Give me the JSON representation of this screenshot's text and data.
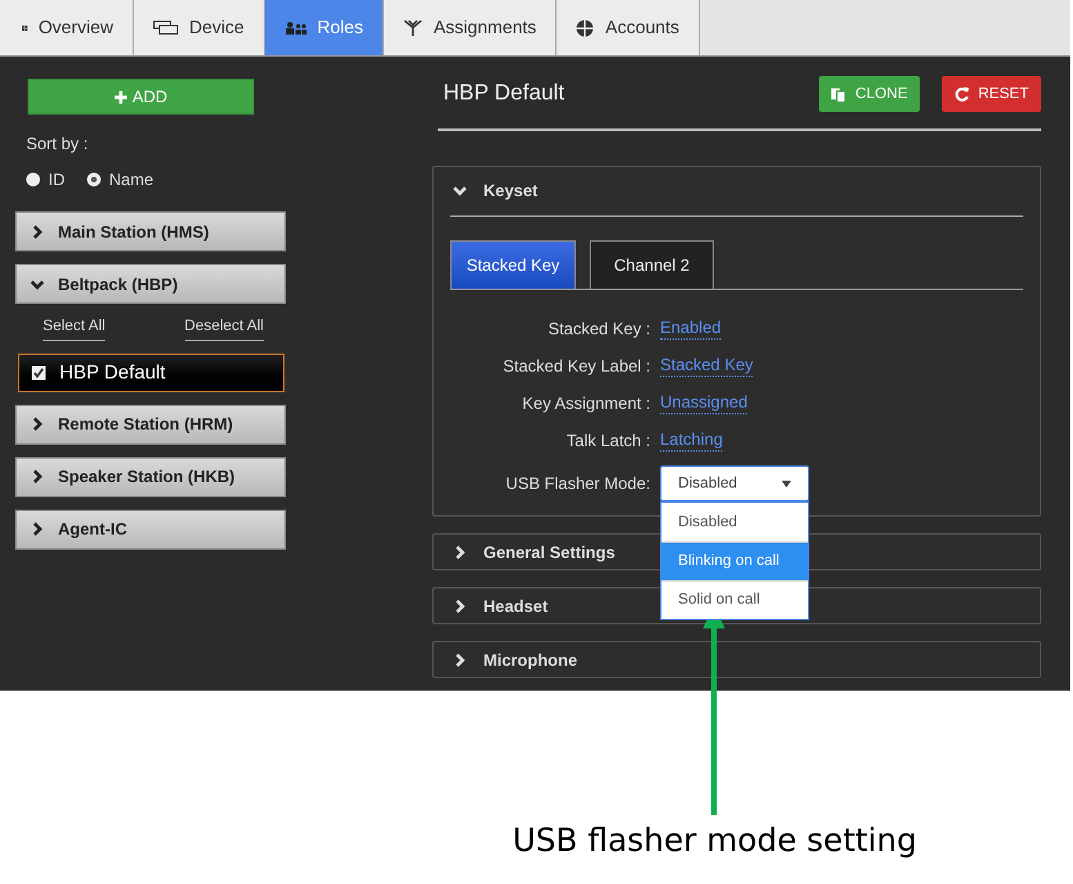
{
  "tabs": [
    {
      "label": "Overview",
      "selected": false
    },
    {
      "label": "Device",
      "selected": false
    },
    {
      "label": "Roles",
      "selected": true
    },
    {
      "label": "Assignments",
      "selected": false
    },
    {
      "label": "Accounts",
      "selected": false
    }
  ],
  "sidebar": {
    "add_button": "ADD",
    "sort_by": "Sort by :",
    "sort_options": [
      {
        "label": "ID",
        "selected": false
      },
      {
        "label": "Name",
        "selected": true
      }
    ],
    "groups": [
      {
        "label": "Main Station (HMS)",
        "expanded": false
      },
      {
        "label": "Beltpack (HBP)",
        "expanded": true,
        "select_all": "Select All",
        "deselect_all": "Deselect All",
        "items": [
          {
            "label": "HBP Default",
            "checked": true,
            "selected": true
          }
        ]
      },
      {
        "label": "Remote Station (HRM)",
        "expanded": false
      },
      {
        "label": "Speaker Station (HKB)",
        "expanded": false
      },
      {
        "label": "Agent-IC",
        "expanded": false
      }
    ]
  },
  "main": {
    "title": "HBP Default",
    "clone_button": "CLONE",
    "reset_button": "RESET",
    "sections": [
      {
        "title": "Keyset",
        "expanded": true,
        "tabs": [
          {
            "label": "Stacked Key",
            "selected": true
          },
          {
            "label": "Channel 2",
            "selected": false
          }
        ],
        "fields": [
          {
            "kind": "link",
            "label": "Stacked Key :",
            "value": "Enabled"
          },
          {
            "kind": "link",
            "label": "Stacked Key Label :",
            "value": "Stacked Key"
          },
          {
            "kind": "link",
            "label": "Key Assignment :",
            "value": "Unassigned"
          },
          {
            "kind": "link",
            "label": "Talk Latch :",
            "value": "Latching"
          },
          {
            "kind": "select",
            "label": "USB Flasher Mode:",
            "value": "Disabled",
            "expanded": true,
            "options": [
              {
                "label": "Disabled",
                "highlighted": false
              },
              {
                "label": "Blinking on call",
                "highlighted": true
              },
              {
                "label": "Solid on call",
                "highlighted": false
              }
            ]
          }
        ]
      },
      {
        "title": "General Settings",
        "expanded": false
      },
      {
        "title": "Headset",
        "expanded": false
      },
      {
        "title": "Microphone",
        "expanded": false
      }
    ]
  },
  "annotation": {
    "caption": "USB flasher mode setting"
  }
}
